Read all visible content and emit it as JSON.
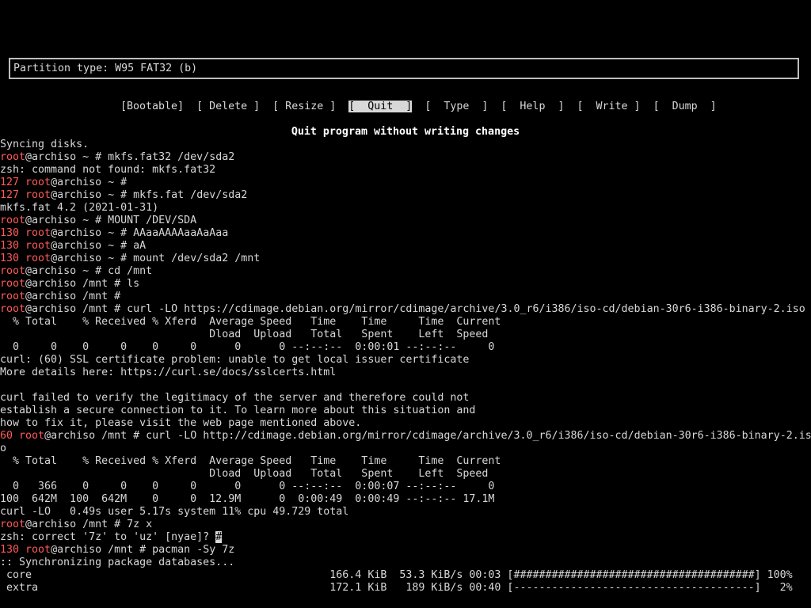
{
  "partition": {
    "text": "Partition type: W95 FAT32 (b)"
  },
  "menu": {
    "items": [
      {
        "label": "[Bootable]",
        "selected": false
      },
      {
        "label": "[ Delete ]",
        "selected": false
      },
      {
        "label": "[ Resize ]",
        "selected": false
      },
      {
        "label": "[  Quit  ]",
        "selected": true
      },
      {
        "label": "[  Type  ]",
        "selected": false
      },
      {
        "label": "[  Help  ]",
        "selected": false
      },
      {
        "label": "[  Write ]",
        "selected": false
      },
      {
        "label": "[  Dump  ]",
        "selected": false
      }
    ]
  },
  "hint": "Quit program without writing changes",
  "colors": {
    "background": "#000000",
    "text": "#d8d8d8",
    "prompt_user": "#ff5a5a",
    "exit_code": "#ff5a5a"
  },
  "terminal": {
    "lines": [
      {
        "text": "Syncing disks."
      },
      {
        "user": "root",
        "host": "@archiso",
        "cwd": " ~ # ",
        "cmd": "mkfs.fat32 /dev/sda2"
      },
      {
        "text": "zsh: command not found: mkfs.fat32"
      },
      {
        "code": "127 ",
        "user": "root",
        "host": "@archiso",
        "cwd": " ~ # ",
        "cmd": ""
      },
      {
        "code": "127 ",
        "user": "root",
        "host": "@archiso",
        "cwd": " ~ # ",
        "cmd": "mkfs.fat /dev/sda2"
      },
      {
        "text": "mkfs.fat 4.2 (2021-01-31)"
      },
      {
        "user": "root",
        "host": "@archiso",
        "cwd": " ~ # ",
        "cmd": "MOUNT /DEV/SDA"
      },
      {
        "code": "130 ",
        "user": "root",
        "host": "@archiso",
        "cwd": " ~ # ",
        "cmd": "AAaaAAAAaaAaAaa"
      },
      {
        "code": "130 ",
        "user": "root",
        "host": "@archiso",
        "cwd": " ~ # ",
        "cmd": "aA"
      },
      {
        "code": "130 ",
        "user": "root",
        "host": "@archiso",
        "cwd": " ~ # ",
        "cmd": "mount /dev/sda2 /mnt"
      },
      {
        "user": "root",
        "host": "@archiso",
        "cwd": " ~ # ",
        "cmd": "cd /mnt"
      },
      {
        "user": "root",
        "host": "@archiso",
        "cwd": " /mnt # ",
        "cmd": "ls"
      },
      {
        "user": "root",
        "host": "@archiso",
        "cwd": " /mnt # ",
        "cmd": ""
      },
      {
        "user": "root",
        "host": "@archiso",
        "cwd": " /mnt # ",
        "cmd": "curl -LO https://cdimage.debian.org/mirror/cdimage/archive/3.0_r6/i386/iso-cd/debian-30r6-i386-binary-2.iso"
      },
      {
        "text": "  % Total    % Received % Xferd  Average Speed   Time    Time     Time  Current"
      },
      {
        "text": "                                 Dload  Upload   Total   Spent    Left  Speed"
      },
      {
        "text": "  0     0    0     0    0     0      0      0 --:--:--  0:00:01 --:--:--     0"
      },
      {
        "text": "curl: (60) SSL certificate problem: unable to get local issuer certificate"
      },
      {
        "text": "More details here: https://curl.se/docs/sslcerts.html"
      },
      {
        "text": ""
      },
      {
        "text": "curl failed to verify the legitimacy of the server and therefore could not"
      },
      {
        "text": "establish a secure connection to it. To learn more about this situation and"
      },
      {
        "text": "how to fix it, please visit the web page mentioned above."
      },
      {
        "code": "60 ",
        "user": "root",
        "host": "@archiso",
        "cwd": " /mnt # ",
        "cmd": "curl -LO http://cdimage.debian.org/mirror/cdimage/archive/3.0_r6/i386/iso-cd/debian-30r6-i386-binary-2.is"
      },
      {
        "text": "o"
      },
      {
        "text": "  % Total    % Received % Xferd  Average Speed   Time    Time     Time  Current"
      },
      {
        "text": "                                 Dload  Upload   Total   Spent    Left  Speed"
      },
      {
        "text": "  0   366    0     0    0     0      0      0 --:--:--  0:00:07 --:--:--     0"
      },
      {
        "text": "100  642M  100  642M    0     0  12.9M      0  0:00:49  0:00:49 --:--:-- 17.1M"
      },
      {
        "text": "curl -LO   0.49s user 5.17s system 11% cpu 49.729 total"
      },
      {
        "user": "root",
        "host": "@archiso",
        "cwd": " /mnt # ",
        "cmd": "7z x"
      },
      {
        "text": "zsh: correct '7z' to 'uz' [nyae]? ",
        "cursor": "#"
      },
      {
        "code": "130 ",
        "user": "root",
        "host": "@archiso",
        "cwd": " /mnt # ",
        "cmd": "pacman -Sy 7z"
      },
      {
        "text": ":: Synchronizing package databases..."
      },
      {
        "text": " core                                               166.4 KiB  53.3 KiB/s 00:03 [######################################] 100%"
      },
      {
        "text": " extra                                              172.1 KiB   189 KiB/s 00:40 [--------------------------------------]   2%"
      }
    ]
  }
}
